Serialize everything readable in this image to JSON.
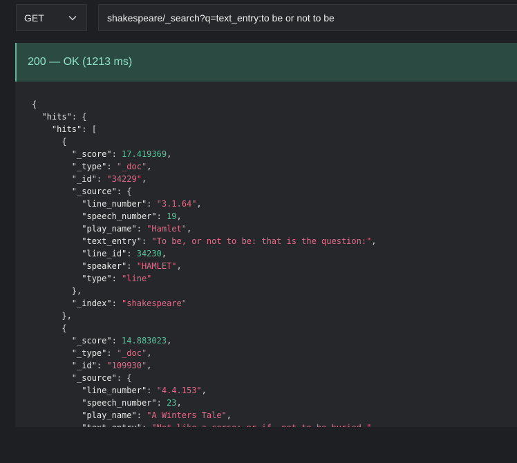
{
  "request": {
    "method": "GET",
    "url": "shakespeare/_search?q=text_entry:to be or not to be"
  },
  "response": {
    "status": "200 — OK (1213 ms)",
    "lines": [
      [
        [
          "p",
          "{"
        ]
      ],
      [
        [
          "p",
          "  "
        ],
        [
          "k",
          "\"hits\""
        ],
        [
          "p",
          ": {"
        ]
      ],
      [
        [
          "p",
          "    "
        ],
        [
          "k",
          "\"hits\""
        ],
        [
          "p",
          ": ["
        ]
      ],
      [
        [
          "p",
          "      {"
        ]
      ],
      [
        [
          "p",
          "        "
        ],
        [
          "k",
          "\"_score\""
        ],
        [
          "p",
          ": "
        ],
        [
          "n",
          "17.419369"
        ],
        [
          "p",
          ","
        ]
      ],
      [
        [
          "p",
          "        "
        ],
        [
          "k",
          "\"_type\""
        ],
        [
          "p",
          ": "
        ],
        [
          "s",
          "\"_doc\""
        ],
        [
          "p",
          ","
        ]
      ],
      [
        [
          "p",
          "        "
        ],
        [
          "k",
          "\"_id\""
        ],
        [
          "p",
          ": "
        ],
        [
          "s",
          "\"34229\""
        ],
        [
          "p",
          ","
        ]
      ],
      [
        [
          "p",
          "        "
        ],
        [
          "k",
          "\"_source\""
        ],
        [
          "p",
          ": {"
        ]
      ],
      [
        [
          "p",
          "          "
        ],
        [
          "k",
          "\"line_number\""
        ],
        [
          "p",
          ": "
        ],
        [
          "s",
          "\"3.1.64\""
        ],
        [
          "p",
          ","
        ]
      ],
      [
        [
          "p",
          "          "
        ],
        [
          "k",
          "\"speech_number\""
        ],
        [
          "p",
          ": "
        ],
        [
          "n",
          "19"
        ],
        [
          "p",
          ","
        ]
      ],
      [
        [
          "p",
          "          "
        ],
        [
          "k",
          "\"play_name\""
        ],
        [
          "p",
          ": "
        ],
        [
          "s",
          "\"Hamlet\""
        ],
        [
          "p",
          ","
        ]
      ],
      [
        [
          "p",
          "          "
        ],
        [
          "k",
          "\"text_entry\""
        ],
        [
          "p",
          ": "
        ],
        [
          "s",
          "\"To be, or not to be: that is the question:\""
        ],
        [
          "p",
          ","
        ]
      ],
      [
        [
          "p",
          "          "
        ],
        [
          "k",
          "\"line_id\""
        ],
        [
          "p",
          ": "
        ],
        [
          "n",
          "34230"
        ],
        [
          "p",
          ","
        ]
      ],
      [
        [
          "p",
          "          "
        ],
        [
          "k",
          "\"speaker\""
        ],
        [
          "p",
          ": "
        ],
        [
          "s",
          "\"HAMLET\""
        ],
        [
          "p",
          ","
        ]
      ],
      [
        [
          "p",
          "          "
        ],
        [
          "k",
          "\"type\""
        ],
        [
          "p",
          ": "
        ],
        [
          "s",
          "\"line\""
        ]
      ],
      [
        [
          "p",
          "        },"
        ]
      ],
      [
        [
          "p",
          "        "
        ],
        [
          "k",
          "\"_index\""
        ],
        [
          "p",
          ": "
        ],
        [
          "s",
          "\"shakespeare\""
        ]
      ],
      [
        [
          "p",
          "      },"
        ]
      ],
      [
        [
          "p",
          "      {"
        ]
      ],
      [
        [
          "p",
          "        "
        ],
        [
          "k",
          "\"_score\""
        ],
        [
          "p",
          ": "
        ],
        [
          "n",
          "14.883023"
        ],
        [
          "p",
          ","
        ]
      ],
      [
        [
          "p",
          "        "
        ],
        [
          "k",
          "\"_type\""
        ],
        [
          "p",
          ": "
        ],
        [
          "s",
          "\"_doc\""
        ],
        [
          "p",
          ","
        ]
      ],
      [
        [
          "p",
          "        "
        ],
        [
          "k",
          "\"_id\""
        ],
        [
          "p",
          ": "
        ],
        [
          "s",
          "\"109930\""
        ],
        [
          "p",
          ","
        ]
      ],
      [
        [
          "p",
          "        "
        ],
        [
          "k",
          "\"_source\""
        ],
        [
          "p",
          ": {"
        ]
      ],
      [
        [
          "p",
          "          "
        ],
        [
          "k",
          "\"line_number\""
        ],
        [
          "p",
          ": "
        ],
        [
          "s",
          "\"4.4.153\""
        ],
        [
          "p",
          ","
        ]
      ],
      [
        [
          "p",
          "          "
        ],
        [
          "k",
          "\"speech_number\""
        ],
        [
          "p",
          ": "
        ],
        [
          "n",
          "23"
        ],
        [
          "p",
          ","
        ]
      ],
      [
        [
          "p",
          "          "
        ],
        [
          "k",
          "\"play_name\""
        ],
        [
          "p",
          ": "
        ],
        [
          "s",
          "\"A Winters Tale\""
        ],
        [
          "p",
          ","
        ]
      ],
      [
        [
          "p",
          "          "
        ],
        [
          "k",
          "\"text_entry\""
        ],
        [
          "p",
          ": "
        ],
        [
          "s",
          "\"Not like a corse; or if, not to be buried,\""
        ],
        [
          "p",
          ","
        ]
      ]
    ]
  },
  "colors": {
    "background": "#1e1f22",
    "panel": "#26272a",
    "status_bg": "#2b4a42",
    "status_text": "#8fe3c4",
    "string": "#e06c8a",
    "number": "#58c29b"
  },
  "icons": {
    "method_dropdown": "chevron-down-icon"
  }
}
